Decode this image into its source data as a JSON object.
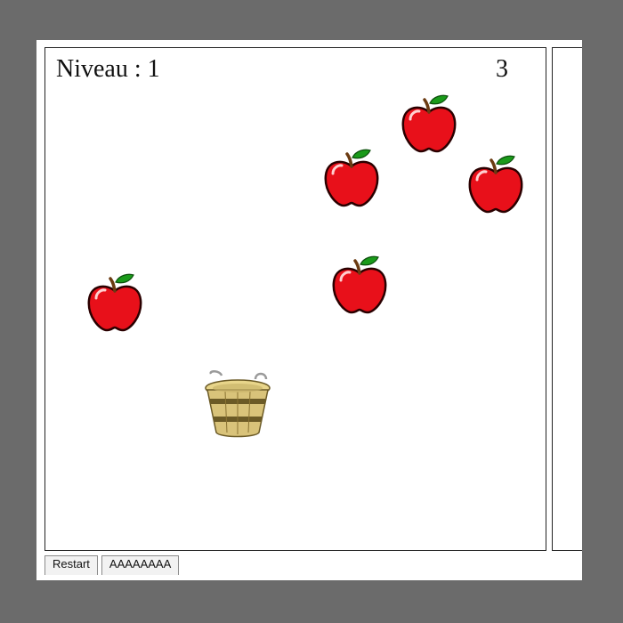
{
  "hud": {
    "level_text": "Niveau : 1",
    "score": "3"
  },
  "game": {
    "apple_icon": "apple-icon",
    "basket_icon": "basket-icon",
    "apple_count": 5
  },
  "buttons": {
    "restart_label": "Restart",
    "second_label": "AAAAAAAA"
  },
  "colors": {
    "background": "#6b6b6b",
    "apple_red": "#e8101a",
    "leaf_green": "#1a9a1a",
    "basket_wood": "#d8c47a"
  }
}
